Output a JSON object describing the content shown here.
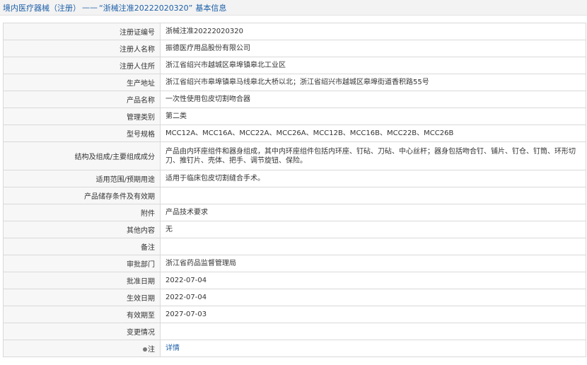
{
  "breadcrumb": {
    "section": "境内医疗器械（注册）",
    "separator": "——",
    "record": "“浙械注准20222020320”",
    "page": "基本信息"
  },
  "rows": [
    {
      "label": "注册证编号",
      "value": "浙械注准20222020320"
    },
    {
      "label": "注册人名称",
      "value": "振德医疗用品股份有限公司"
    },
    {
      "label": "注册人住所",
      "value": "浙江省绍兴市越城区皋埠镇皋北工业区"
    },
    {
      "label": "生产地址",
      "value": "浙江省绍兴市皋埠镇皋马线皋北大桥以北；浙江省绍兴市越城区皋埠街道香积路55号"
    },
    {
      "label": "产品名称",
      "value": "一次性使用包皮切割吻合器"
    },
    {
      "label": "管理类别",
      "value": "第二类"
    },
    {
      "label": "型号规格",
      "value": "MCC12A、MCC16A、MCC22A、MCC26A、MCC12B、MCC16B、MCC22B、MCC26B"
    },
    {
      "label": "结构及组成/主要组成成分",
      "value": "产品由内环座组件和器身组成，其中内环座组件包括内环座、钉砧、刀砧、中心丝杆；器身包括吻合钉、铺片、钉仓、钉筒、环形切刀、推钉片、壳体、把手、调节旋钮、保险。"
    },
    {
      "label": "适用范围/预期用途",
      "value": "适用于临床包皮切割缝合手术。"
    },
    {
      "label": "产品储存条件及有效期",
      "value": ""
    },
    {
      "label": "附件",
      "value": "产品技术要求"
    },
    {
      "label": "其他内容",
      "value": "无"
    },
    {
      "label": "备注",
      "value": ""
    },
    {
      "label": "审批部门",
      "value": "浙江省药品监督管理局"
    },
    {
      "label": "批准日期",
      "value": "2022-07-04"
    },
    {
      "label": "生效日期",
      "value": "2022-07-04"
    },
    {
      "label": "有效期至",
      "value": "2027-07-03"
    },
    {
      "label": "变更情况",
      "value": ""
    },
    {
      "label": "注",
      "value": "详情"
    }
  ],
  "colors": {
    "link": "#1c5fa8",
    "label_bg": "#f7f7f7",
    "border": "#d9d9d9"
  },
  "icons": {
    "note": "info-dot-icon"
  }
}
